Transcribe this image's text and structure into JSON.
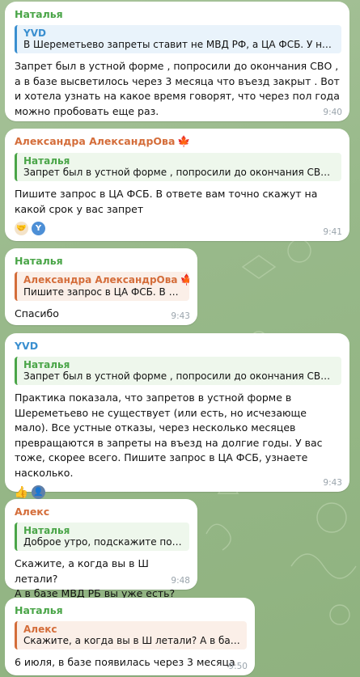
{
  "messages": [
    {
      "sender": "Наталья",
      "reply_name": "YVD",
      "reply_text": "В Шереметьево запреты ставит не МВД РФ, а ЦА ФСБ. У них н...",
      "text": "Запрет был в устной форме , попросили до окончания СВО , а в базе высветилось через 3 месяца что въезд закрыт . Вот и хотела узнать на какое время говорят, что через пол года можно пробовать еще раз.",
      "time": "9:40"
    },
    {
      "sender": "Александра АлександрОва",
      "sender_badge": "🍁",
      "reply_name": "Наталья",
      "reply_text": "Запрет был в устной форме , попросили до окончания СВО , ...",
      "text": "Пишите запрос в ЦА ФСБ. В ответе вам точно скажут на какой срок у вас запрет",
      "reactions": [
        "🤝",
        "Y"
      ],
      "time": "9:41"
    },
    {
      "sender": "Наталья",
      "reply_name": "Александра АлександрОва",
      "reply_badge": "🍁",
      "reply_text": "Пишите запрос в ЦА ФСБ. В от...",
      "text": "Спасибо",
      "time": "9:43"
    },
    {
      "sender": "YVD",
      "reply_name": "Наталья",
      "reply_text": "Запрет был в устной форме , попросили до окончания СВО , ...",
      "text": "Практика показала, что запретов в устной форме в Шереметьево не существует (или есть, но исчезающе мало). Все устные отказы, через несколько месяцев превращаются в запреты на въезд на долгие годы. У вас тоже, скорее всего. Пишите запрос в ЦА ФСБ, узнаете насколько.",
      "reactions": [
        "👍",
        "👤"
      ],
      "time": "9:43"
    },
    {
      "sender": "Алекс",
      "reply_name": "Наталья",
      "reply_text": "Доброе утро, подскажите пож...",
      "text": "Скажите,  а когда вы в Ш летали?\nА в базе МВД РБ вы уже есть?",
      "time": "9:48"
    },
    {
      "sender": "Наталья",
      "reply_name": "Алекс",
      "reply_text": "Скажите,  а когда вы в Ш летали? А в базе ...",
      "text": "6 июля, в базе появилась через 3 месяца",
      "time": "9:50"
    }
  ]
}
